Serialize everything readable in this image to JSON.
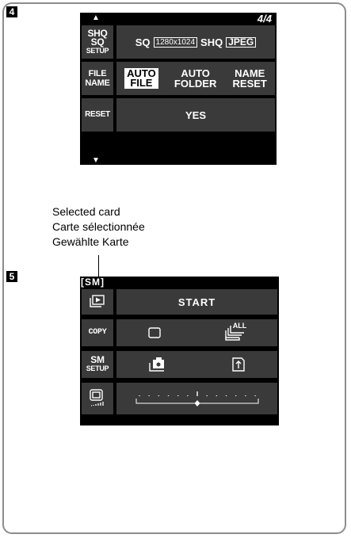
{
  "steps": {
    "step4": "4",
    "step5": "5"
  },
  "screen4": {
    "up_arrow": "▲",
    "down_arrow": "▼",
    "page": "4/4",
    "row1": {
      "label_lines": [
        "SHQ",
        "SQ",
        "SETUP"
      ],
      "sq": "SQ",
      "resolution": "1280x1024",
      "shq": "SHQ",
      "format": "JPEG"
    },
    "row2": {
      "label_lines": [
        "FILE",
        "NAME"
      ],
      "options": [
        {
          "line1": "AUTO",
          "line2": "FILE",
          "selected": true
        },
        {
          "line1": "AUTO",
          "line2": "FOLDER",
          "selected": false
        },
        {
          "line1": "NAME",
          "line2": "RESET",
          "selected": false
        }
      ]
    },
    "row3": {
      "label": "RESET",
      "value": "YES"
    }
  },
  "captions": [
    "Selected card",
    "Carte sélectionnée",
    "Gewählte Karte"
  ],
  "screen5": {
    "card": "[SM]",
    "start": "START",
    "copy_label": "COPY",
    "copy_all_text": "ALL",
    "sm_setup_label_lines": [
      "SM",
      "SETUP"
    ],
    "brightness_level": 0.5,
    "brightness_ticks": 13
  },
  "icons": [
    "playback-icon",
    "single-frame-icon",
    "copy-all-icon",
    "card-format-icon",
    "card-clean-icon",
    "monitor-brightness-icon"
  ],
  "colors": {
    "lcd_bg": "#000000",
    "cell_bg": "#3a3a3a",
    "text": "#ffffff",
    "frame": "#8c8c8c"
  }
}
